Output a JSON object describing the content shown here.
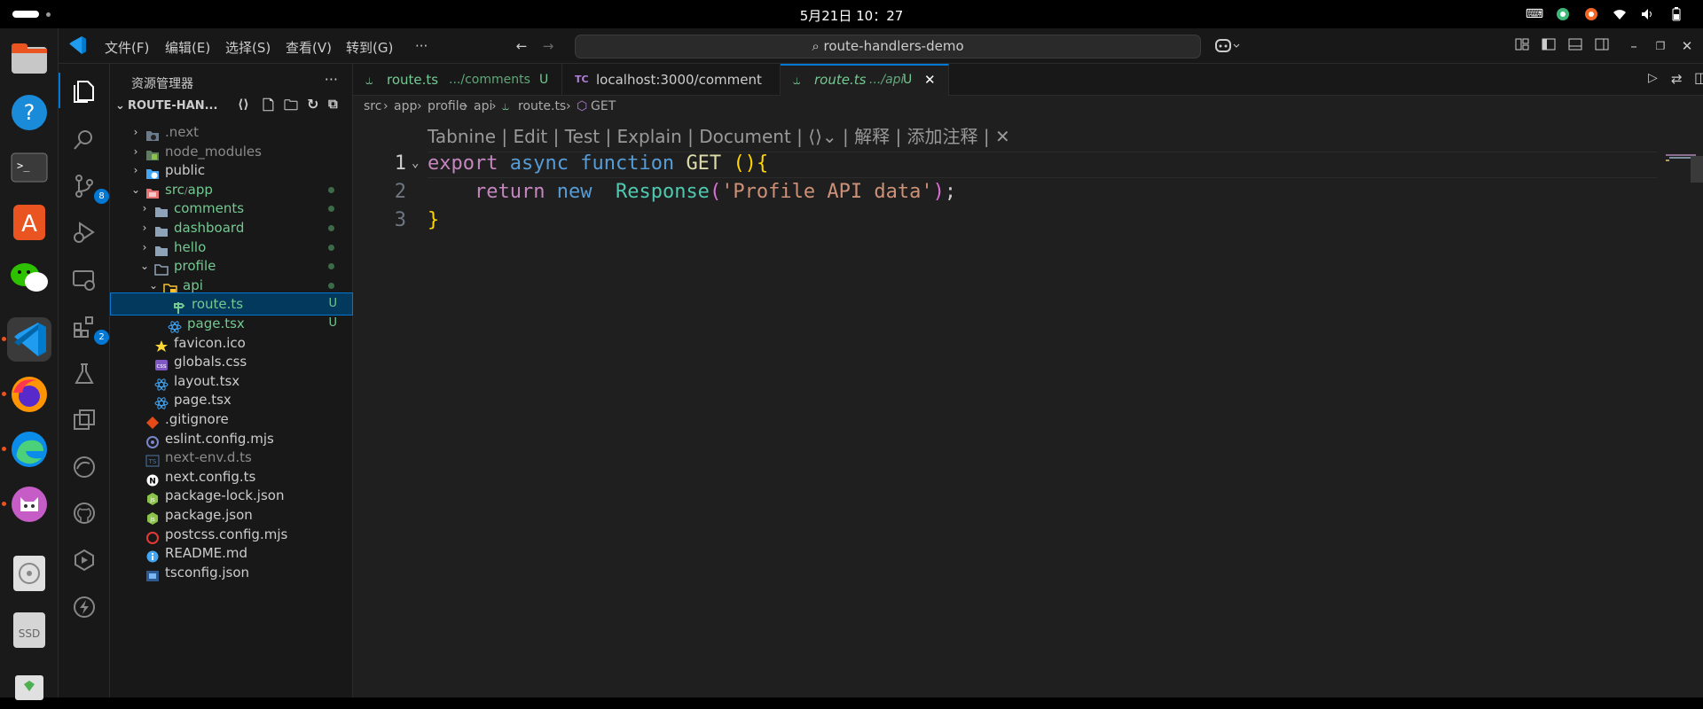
{
  "system": {
    "clock": "5月21日 10：27"
  },
  "menu": {
    "items": [
      "文件(F)",
      "编辑(E)",
      "选择(S)",
      "查看(V)",
      "转到(G)",
      "···"
    ],
    "search": "route-handlers-demo"
  },
  "activity": {
    "scm_badge": "8",
    "ext_badge": "2"
  },
  "explorer": {
    "title": "资源管理器",
    "more": "···",
    "root": "ROUTE-HAN...",
    "items": [
      {
        "name": ".next",
        "depth": 0,
        "twist": "›",
        "icon": "folder-next-icon",
        "muted": true
      },
      {
        "name": "node_modules",
        "depth": 0,
        "twist": "›",
        "icon": "folder-green-icon",
        "muted": true
      },
      {
        "name": "public",
        "depth": 0,
        "twist": "›",
        "icon": "folder-globe-icon"
      },
      {
        "name": "src",
        "sep": "/",
        "name2": "app",
        "depth": 0,
        "twist": "⌄",
        "icon": "folder-red-icon",
        "dot": true,
        "green": true
      },
      {
        "name": "comments",
        "depth": 1,
        "twist": "›",
        "icon": "folder-icon",
        "dot": true,
        "green": true
      },
      {
        "name": "dashboard",
        "depth": 1,
        "twist": "›",
        "icon": "folder-icon",
        "dot": true,
        "green": true
      },
      {
        "name": "hello",
        "depth": 1,
        "twist": "›",
        "icon": "folder-icon",
        "dot": true,
        "green": true
      },
      {
        "name": "profile",
        "depth": 1,
        "twist": "⌄",
        "icon": "folder-open-icon",
        "dot": true,
        "green": true
      },
      {
        "name": "api",
        "depth": 2,
        "twist": "⌄",
        "icon": "folder-api-icon",
        "dot": true,
        "green": true
      },
      {
        "name": "route.ts",
        "depth": 3,
        "icon": "route-icon",
        "mark": "U",
        "green": true,
        "selected": true
      },
      {
        "name": "page.tsx",
        "depth": 2.5,
        "icon": "react-icon",
        "mark": "U",
        "green": true
      },
      {
        "name": "favicon.ico",
        "depth": 1,
        "icon": "star-icon"
      },
      {
        "name": "globals.css",
        "depth": 1,
        "icon": "css-icon"
      },
      {
        "name": "layout.tsx",
        "depth": 1,
        "icon": "react-icon"
      },
      {
        "name": "page.tsx",
        "depth": 1,
        "icon": "react-icon"
      },
      {
        "name": ".gitignore",
        "depth": 0,
        "icon": "git-icon"
      },
      {
        "name": "eslint.config.mjs",
        "depth": 0,
        "icon": "eslint-icon"
      },
      {
        "name": "next-env.d.ts",
        "depth": 0,
        "icon": "ts-icon",
        "muted": true
      },
      {
        "name": "next.config.ts",
        "depth": 0,
        "icon": "next-icon"
      },
      {
        "name": "package-lock.json",
        "depth": 0,
        "icon": "node-icon"
      },
      {
        "name": "package.json",
        "depth": 0,
        "icon": "node-icon"
      },
      {
        "name": "postcss.config.mjs",
        "depth": 0,
        "icon": "postcss-icon"
      },
      {
        "name": "README.md",
        "depth": 0,
        "icon": "info-icon"
      },
      {
        "name": "tsconfig.json",
        "depth": 0,
        "icon": "tsconfig-icon"
      }
    ]
  },
  "tabs": [
    {
      "name": "route.ts",
      "hint": ".../comments",
      "mark": "U",
      "icon": "route-icon"
    },
    {
      "name": "localhost:3000/comment",
      "icon": "tc-icon",
      "badge": "TC"
    },
    {
      "name": "route.ts",
      "hint": ".../api",
      "mark": "U",
      "icon": "route-icon",
      "active": true,
      "close": "✕"
    }
  ],
  "breadcrumb": [
    "src",
    "app",
    "profile",
    "api",
    "route.ts",
    "GET"
  ],
  "codelens": "Tabnine | Edit | Test | Explain | Document | ⟨⟩⌄ | 解释 | 添加注释 |",
  "code": {
    "lines": [
      "1",
      "2",
      "3"
    ],
    "l1": {
      "kw1": "export",
      "kw2": "async",
      "kw3": "function",
      "fn": "GET",
      "paren": "()",
      "brace": "{"
    },
    "l2": {
      "kw": "return",
      "kw2": "new",
      "cls": "Response",
      "open": "(",
      "str": "'Profile API data'",
      "close": ")",
      "semi": ";"
    },
    "l3": {
      "brace": "}"
    }
  },
  "colors": {
    "accent": "#0078d4",
    "untracked": "#73c991",
    "keyword": "#c586c0",
    "keyword_blue": "#569cd6",
    "string": "#ce9178",
    "class": "#4ec9b0",
    "function": "#dcdcaa",
    "brace": "#ffd700"
  }
}
